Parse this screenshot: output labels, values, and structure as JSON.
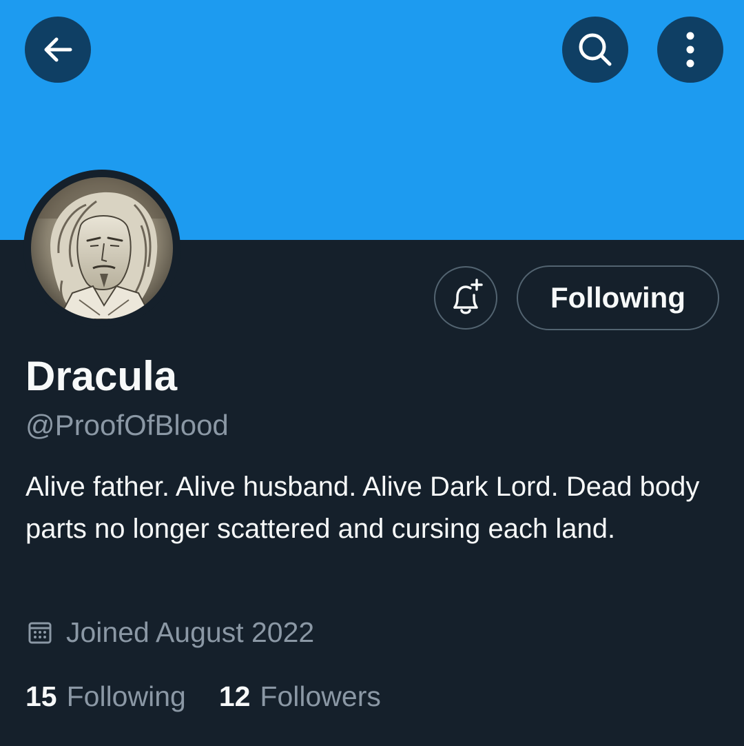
{
  "colors": {
    "banner": "#1d9bf0",
    "background": "#15202b",
    "text_primary": "#f7f9f9",
    "text_secondary": "#8b98a5",
    "button_border": "#536471",
    "header_button_bg": "#0f3f64"
  },
  "header": {
    "back_icon": "arrow-left-icon",
    "search_icon": "search-icon",
    "more_icon": "more-vertical-icon"
  },
  "profile": {
    "avatar_icon": "avatar-illustration",
    "display_name": "Dracula",
    "handle": "@ProofOfBlood",
    "bio": "Alive father. Alive husband. Alive Dark Lord. Dead body parts no longer scattered and cursing each land.",
    "joined_icon": "calendar-icon",
    "joined": "Joined August 2022"
  },
  "actions": {
    "notify_icon": "bell-plus-icon",
    "follow_label": "Following"
  },
  "stats": {
    "following_count": "15",
    "following_label": "Following",
    "followers_count": "12",
    "followers_label": "Followers"
  }
}
